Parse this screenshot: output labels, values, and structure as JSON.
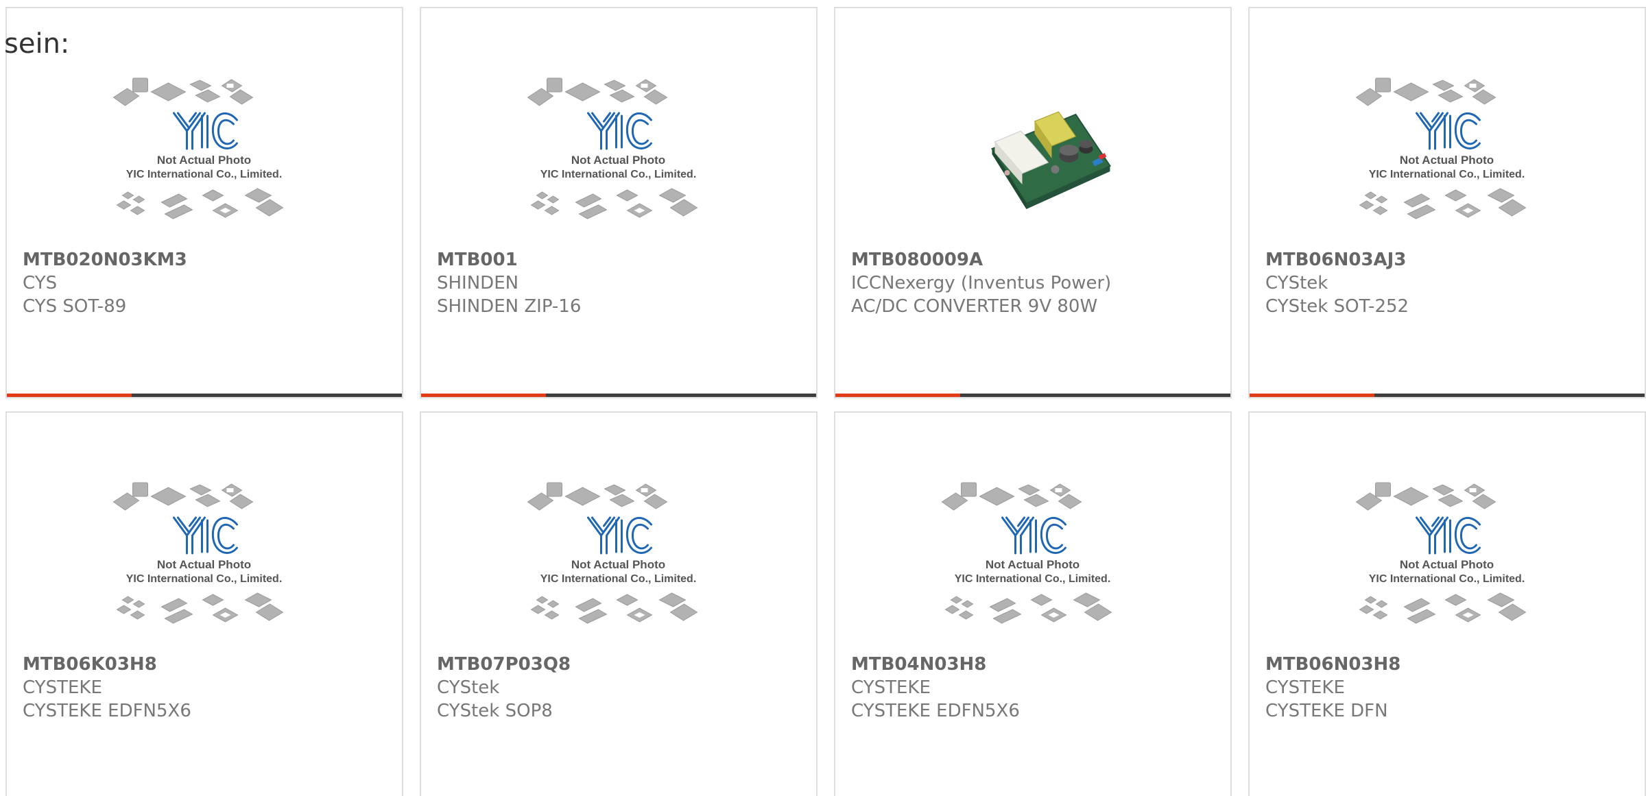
{
  "intro": {
    "text": "sein:"
  },
  "colors": {
    "accent": "#e23b16",
    "bar_dark": "#3e3e3e",
    "border": "#dedede",
    "logo_blue": "#1f67b4"
  },
  "placeholder": {
    "line1": "Not Actual Photo",
    "line2": "YIC International Co., Limited.",
    "logo": "YIC"
  },
  "products": [
    {
      "pn": "MTB020N03KM3",
      "mfr": "CYS",
      "desc": "CYS SOT-89",
      "image": "placeholder"
    },
    {
      "pn": "MTB001",
      "mfr": "SHINDEN",
      "desc": "SHINDEN ZIP-16",
      "image": "placeholder"
    },
    {
      "pn": "MTB080009A",
      "mfr": "ICCNexergy (Inventus Power)",
      "desc": "AC/DC CONVERTER 9V 80W",
      "image": "power-supply-photo"
    },
    {
      "pn": "MTB06N03AJ3",
      "mfr": "CYStek",
      "desc": "CYStek SOT-252",
      "image": "placeholder"
    },
    {
      "pn": "MTB06K03H8",
      "mfr": "CYSTEKE",
      "desc": "CYSTEKE EDFN5X6",
      "image": "placeholder"
    },
    {
      "pn": "MTB07P03Q8",
      "mfr": "CYStek",
      "desc": "CYStek SOP8",
      "image": "placeholder"
    },
    {
      "pn": "MTB04N03H8",
      "mfr": "CYSTEKE",
      "desc": "CYSTEKE EDFN5X6",
      "image": "placeholder"
    },
    {
      "pn": "MTB06N03H8",
      "mfr": "CYSTEKE",
      "desc": "CYSTEKE DFN",
      "image": "placeholder"
    }
  ]
}
